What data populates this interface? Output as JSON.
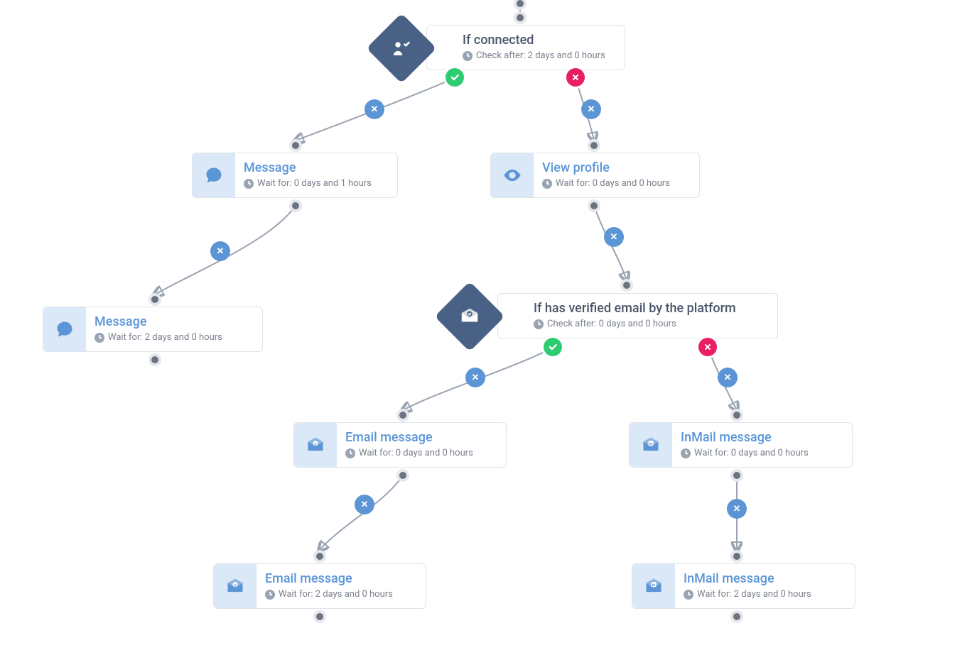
{
  "nodes": {
    "cond1": {
      "title": "If connected",
      "sub_prefix": "Check after:",
      "sub_value": "2 days and 0 hours"
    },
    "msg1": {
      "title": "Message",
      "sub_prefix": "Wait for:",
      "sub_value": "0 days and 1 hours"
    },
    "msg2": {
      "title": "Message",
      "sub_prefix": "Wait for:",
      "sub_value": "2 days and 0 hours"
    },
    "view1": {
      "title": "View profile",
      "sub_prefix": "Wait for:",
      "sub_value": "0 days and 0 hours"
    },
    "cond2": {
      "title": "If has verified email by the platform",
      "sub_prefix": "Check after:",
      "sub_value": "0 days and 0 hours"
    },
    "email1": {
      "title": "Email message",
      "sub_prefix": "Wait for:",
      "sub_value": "0 days and 0 hours"
    },
    "email2": {
      "title": "Email message",
      "sub_prefix": "Wait for:",
      "sub_value": "2 days and 0 hours"
    },
    "inmail1": {
      "title": "InMail message",
      "sub_prefix": "Wait for:",
      "sub_value": "0 days and 0 hours"
    },
    "inmail2": {
      "title": "InMail message",
      "sub_prefix": "Wait for:",
      "sub_value": "2 days and 0 hours"
    }
  }
}
